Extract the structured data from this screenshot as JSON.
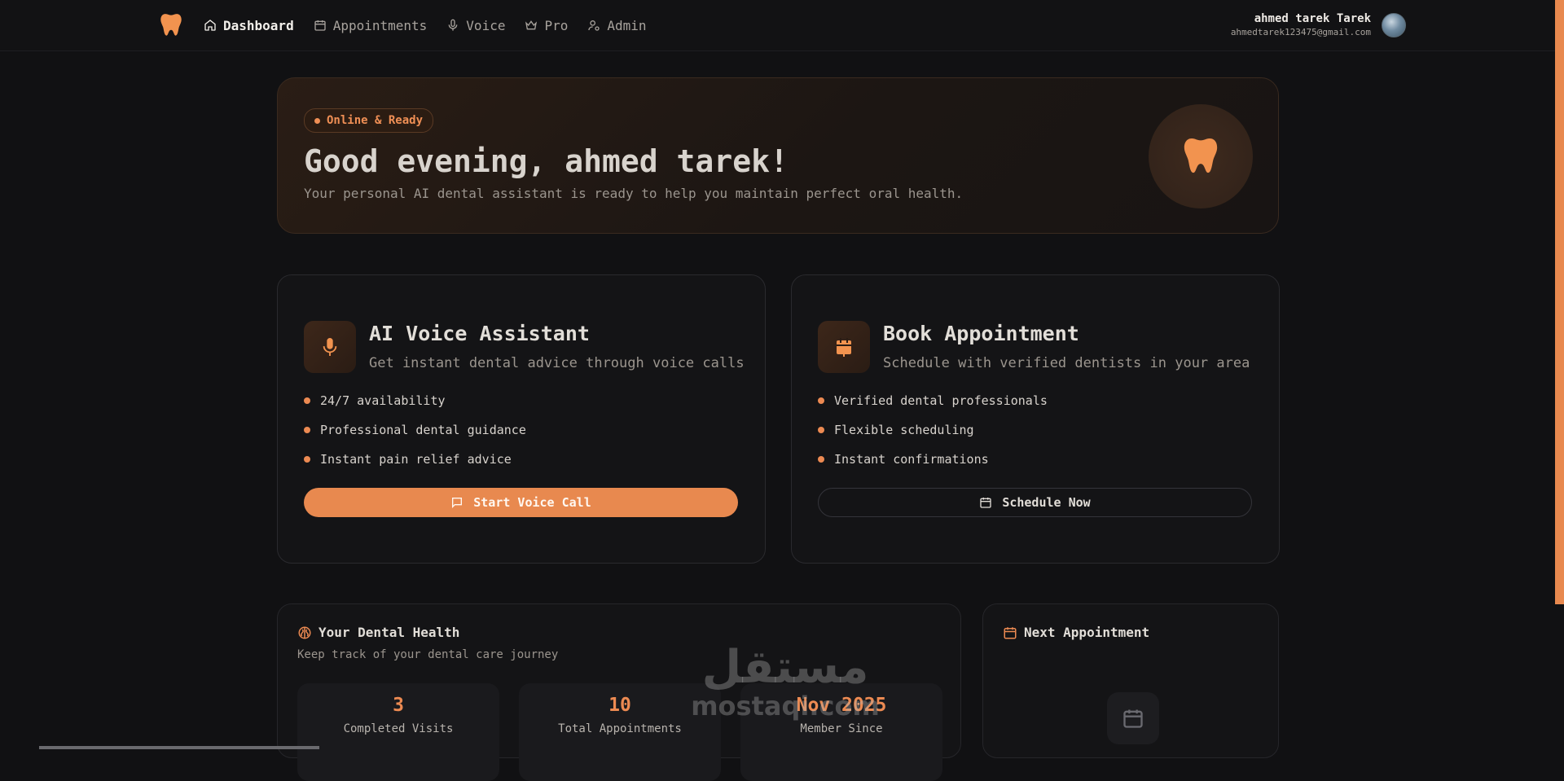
{
  "nav": {
    "items": [
      {
        "label": "Dashboard",
        "icon": "home-icon",
        "active": true
      },
      {
        "label": "Appointments",
        "icon": "calendar-icon",
        "active": false
      },
      {
        "label": "Voice",
        "icon": "microphone-icon",
        "active": false
      },
      {
        "label": "Pro",
        "icon": "crown-icon",
        "active": false
      },
      {
        "label": "Admin",
        "icon": "user-cog-icon",
        "active": false
      }
    ],
    "user": {
      "name": "ahmed tarek Tarek",
      "email": "ahmedtarek123475@gmail.com"
    }
  },
  "hero": {
    "status": "Online & Ready",
    "greeting": "Good evening, ahmed tarek!",
    "subtitle": "Your personal AI dental assistant is ready to help you maintain perfect oral health."
  },
  "voice_card": {
    "title": "AI Voice Assistant",
    "subtitle": "Get instant dental advice through voice calls",
    "features": [
      "24/7 availability",
      "Professional dental guidance",
      "Instant pain relief advice"
    ],
    "button": "Start Voice Call"
  },
  "booking_card": {
    "title": "Book Appointment",
    "subtitle": "Schedule with verified dentists in your area",
    "features": [
      "Verified dental professionals",
      "Flexible scheduling",
      "Instant confirmations"
    ],
    "button": "Schedule Now"
  },
  "health": {
    "title": "Your Dental Health",
    "subtitle": "Keep track of your dental care journey",
    "stats": [
      {
        "value": "3",
        "label": "Completed Visits"
      },
      {
        "value": "10",
        "label": "Total Appointments"
      },
      {
        "value": "Nov 2025",
        "label": "Member Since"
      }
    ]
  },
  "next_appointment": {
    "title": "Next Appointment"
  },
  "watermark": {
    "arabic": "مستقل",
    "latin": "mostaqi.com"
  },
  "colors": {
    "accent": "#e8894f",
    "background": "#111113"
  }
}
